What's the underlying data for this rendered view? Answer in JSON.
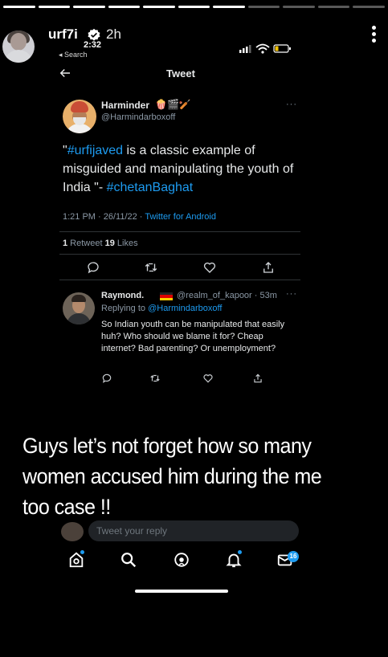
{
  "story": {
    "username": "urf7i",
    "time_ago": "2h",
    "sticker_time": "2:32",
    "progress": {
      "segments": 11,
      "completed": 7
    },
    "caption": "Guys let’s not forget  how so many women accused him during the me too case !!"
  },
  "device": {
    "back_label": "◂ Search"
  },
  "tweet_screen": {
    "title": "Tweet",
    "tweet": {
      "name": "Harminder",
      "emojis": "🍿🎬🏏",
      "handle": "@Harmindarboxoff",
      "more": "···",
      "text_parts": {
        "open_quote": "\"",
        "hashtag1": "#urfijaved",
        "body": " is a classic example of misguided and manipulating the youth of India \"- ",
        "hashtag2": "#chetanBaghat"
      },
      "timestamp": "1:21 PM · 26/11/22 · ",
      "source": "Twitter for Android",
      "retweets_count": "1",
      "retweets_label": " Retweet  ",
      "likes_count": "19",
      "likes_label": " Likes"
    },
    "reply": {
      "name": "Raymond.",
      "handle": "@realm_of_kapoor · 53m",
      "more": "···",
      "replying_label": "Replying to ",
      "replying_to": "@Harmindarboxoff",
      "text": "So Indian youth can be manipulated that easily huh? Who should we blame it for? Cheap internet? Bad parenting? Or unemployment?",
      "flag_colors": [
        "#222222",
        "#dd0000",
        "#ffce00"
      ]
    },
    "compose_placeholder": "Tweet your reply",
    "messages_badge": "16",
    "accent": "#1d9bf0"
  }
}
